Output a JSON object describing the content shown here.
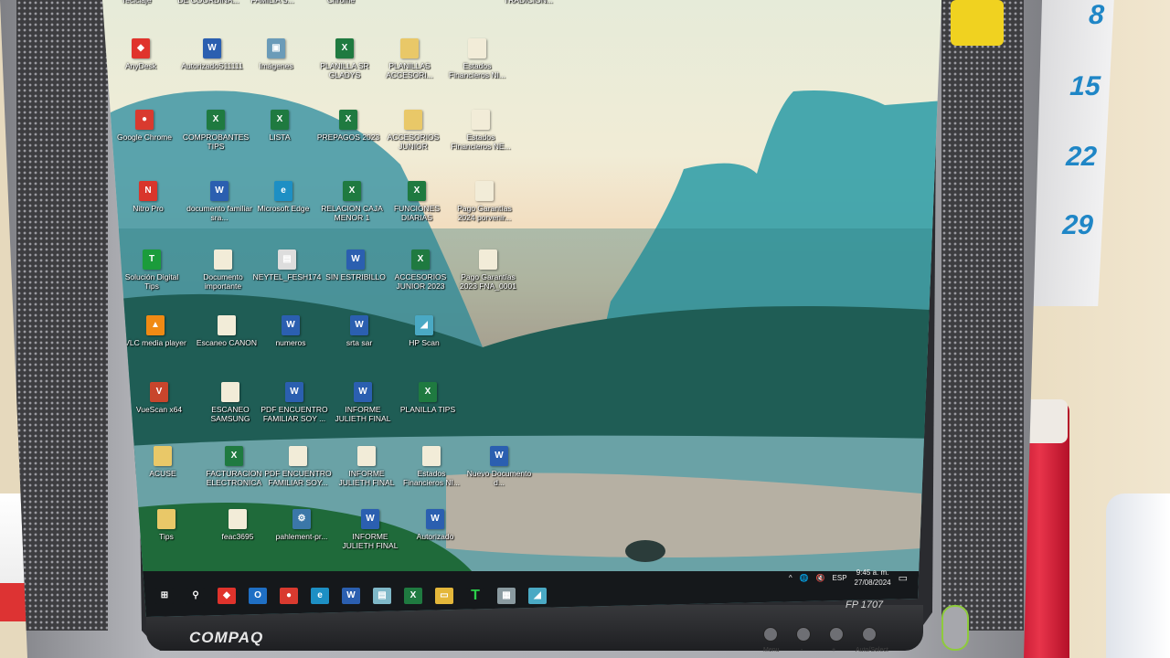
{
  "desktop": {
    "columns": [
      [
        "reciclaje",
        "AnyDesk",
        "Google Chrome",
        "Nitro Pro",
        "Solución Digital Tips",
        "VLC media player",
        "VueScan x64",
        "ACUSE",
        "Tips"
      ],
      [
        "DE COORDINA...",
        "AutorizadoS11111",
        "COMPROBANTES TIPS",
        "documento familiar sra...",
        "Documento importante",
        "Escaneo CANON",
        "ESCANEO SAMSUNG",
        "FACTURACION ELECTRONICA",
        "feac3695"
      ],
      [
        "FAMILIA S...",
        "Imágenes",
        "LISTA",
        "Microsoft Edge",
        "NEYTEL_FESH174",
        "numeros",
        "PDF ENCUENTRO FAMILIAR SOY ...",
        "PDF ENCUENTRO FAMILIAR SOY...",
        "pahlement-pr..."
      ],
      [
        "Chrome",
        "PLANILLA SR GLADYS",
        "PREPAGOS 2023",
        "RELACION CAJA MENOR 1",
        "SIN ESTRIBILLO",
        "srta sar",
        "INFORME JULIETH FINAL",
        "INFORME JULIETH FINAL",
        "INFORME JULIETH FINAL"
      ],
      [
        "",
        "PLANILLAS ACCESORI...",
        "ACCESORIOS JUNIOR",
        "FUNCIONES DIARIAS",
        "ACCESORIOS JUNIOR 2023",
        "HP Scan",
        "PLANILLA TIPS",
        "Estados Financieros NI...",
        "Autorizado"
      ],
      [
        "",
        "Estados Financieros NI...",
        "Estados Financieros NE...",
        "Pago Garantías 2024 porvenir...",
        "Pago Garantías 2023 FNA_0001",
        "",
        "",
        "Nuevo Documento d...",
        ""
      ],
      [
        "TRADICION..."
      ]
    ],
    "types": [
      [
        "file",
        "anydesk",
        "chrome",
        "nitro",
        "tips",
        "vlc",
        "vuescan",
        "folder",
        "folder"
      ],
      [
        "file",
        "word",
        "excel",
        "word",
        "file",
        "file",
        "file",
        "excel",
        "file"
      ],
      [
        "file",
        "image",
        "excel",
        "edge",
        "printer",
        "word",
        "word",
        "file",
        "python"
      ],
      [
        "chrome",
        "excel",
        "excel",
        "excel",
        "word",
        "word",
        "word",
        "file",
        "word"
      ],
      [
        "file",
        "folder",
        "folder",
        "excel",
        "excel",
        "scan",
        "excel",
        "file",
        "word"
      ],
      [
        "file",
        "file",
        "file",
        "file",
        "file",
        "none",
        "none",
        "word",
        "none"
      ],
      [
        "file"
      ]
    ]
  },
  "taskbar": {
    "apps": [
      {
        "name": "start",
        "glyph": "⊞",
        "color": "#15181b"
      },
      {
        "name": "search",
        "glyph": "⚲",
        "color": "#15181b"
      },
      {
        "name": "anydesk",
        "glyph": "◆",
        "color": "#e0332c"
      },
      {
        "name": "outlook",
        "glyph": "O",
        "color": "#1f6fc4"
      },
      {
        "name": "chrome",
        "glyph": "●",
        "color": "#d93a2f"
      },
      {
        "name": "edge",
        "glyph": "e",
        "color": "#1d8fc4"
      },
      {
        "name": "word",
        "glyph": "W",
        "color": "#2b5fb0"
      },
      {
        "name": "notepad",
        "glyph": "▤",
        "color": "#7fb8c8"
      },
      {
        "name": "excel",
        "glyph": "X",
        "color": "#1f7a40"
      },
      {
        "name": "file-explorer",
        "glyph": "▭",
        "color": "#e4b73a"
      },
      {
        "name": "solucion-digital",
        "glyph": "T",
        "color": "#15181b"
      },
      {
        "name": "scanner-app",
        "glyph": "▦",
        "color": "#8a9aa0"
      },
      {
        "name": "hp-scan",
        "glyph": "◢",
        "color": "#4aa9c4"
      }
    ],
    "tray": {
      "chevron": "^",
      "language": "ESP",
      "time": "9:45 a. m.",
      "date": "27/08/2024"
    }
  },
  "monitor": {
    "brand": "COMPAQ",
    "model": "FP 1707",
    "buttons": [
      "Menu",
      "-",
      "+",
      "Auto/Select"
    ]
  },
  "calendar": {
    "days": [
      "8",
      "15",
      "22",
      "29"
    ]
  }
}
